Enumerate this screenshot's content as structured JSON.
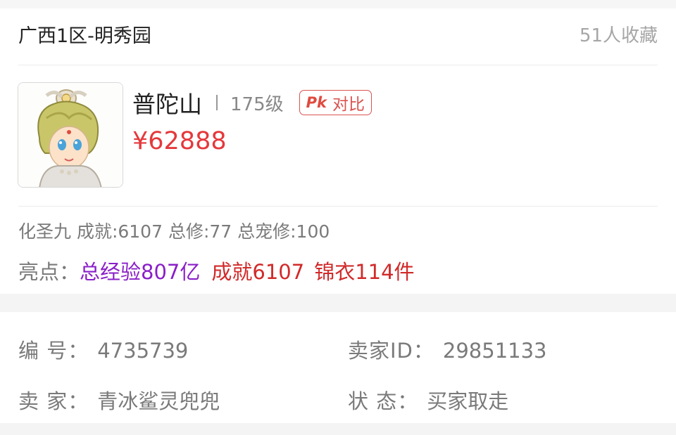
{
  "header": {
    "server": "广西1区-明秀园",
    "favorites": "51人收藏"
  },
  "role": {
    "name": "普陀山",
    "level": "175级",
    "pk_mark": "Pk",
    "compare_label": "对比",
    "price": "¥62888",
    "summary": "化圣九 成就:6107 总修:77 总宠修:100",
    "highlights": {
      "label": "亮点：",
      "exp": "总经验807亿",
      "achievement": "成就6107",
      "clothing": "锦衣114件"
    }
  },
  "details": {
    "id_label": "编  号：",
    "id_value": "4735739",
    "seller_id_label": "卖家ID：",
    "seller_id_value": "29851133",
    "seller_label": "卖  家：",
    "seller_value": "青冰鲨灵兜兜",
    "status_label": "状  态：",
    "status_value": "买家取走"
  },
  "colors": {
    "price": "#e5383b",
    "exp_highlight": "#8a1fc7",
    "red_highlight": "#d12a2a"
  }
}
